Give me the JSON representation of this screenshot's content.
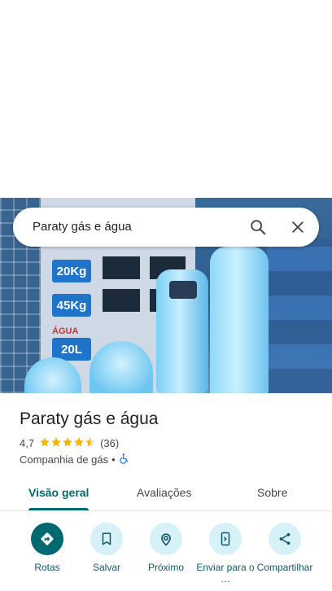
{
  "search": {
    "query": "Paraty gás e água"
  },
  "photo": {
    "price_tags": [
      "20Kg",
      "45Kg",
      "20L"
    ],
    "agua_label": "ÁGUA"
  },
  "place": {
    "name": "Paraty gás e água",
    "rating": "4,7",
    "review_count": "(36)",
    "stars_filled": 4.5,
    "category": "Companhia de gás",
    "separator": "•"
  },
  "tabs": [
    {
      "label": "Visão geral",
      "active": true
    },
    {
      "label": "Avaliações",
      "active": false
    },
    {
      "label": "Sobre",
      "active": false
    }
  ],
  "actions": [
    {
      "label": "Rotas",
      "icon": "directions-icon"
    },
    {
      "label": "Salvar",
      "icon": "bookmark-icon"
    },
    {
      "label": "Próximo",
      "icon": "nearby-icon"
    },
    {
      "label": "Enviar para o …",
      "icon": "send-to-phone-icon"
    },
    {
      "label": "Compartilhar",
      "icon": "share-icon"
    }
  ],
  "colors": {
    "accent": "#00696f",
    "action_bg": "#d7f1f9",
    "star": "#f4b400",
    "accessible": "#1a73e8"
  }
}
